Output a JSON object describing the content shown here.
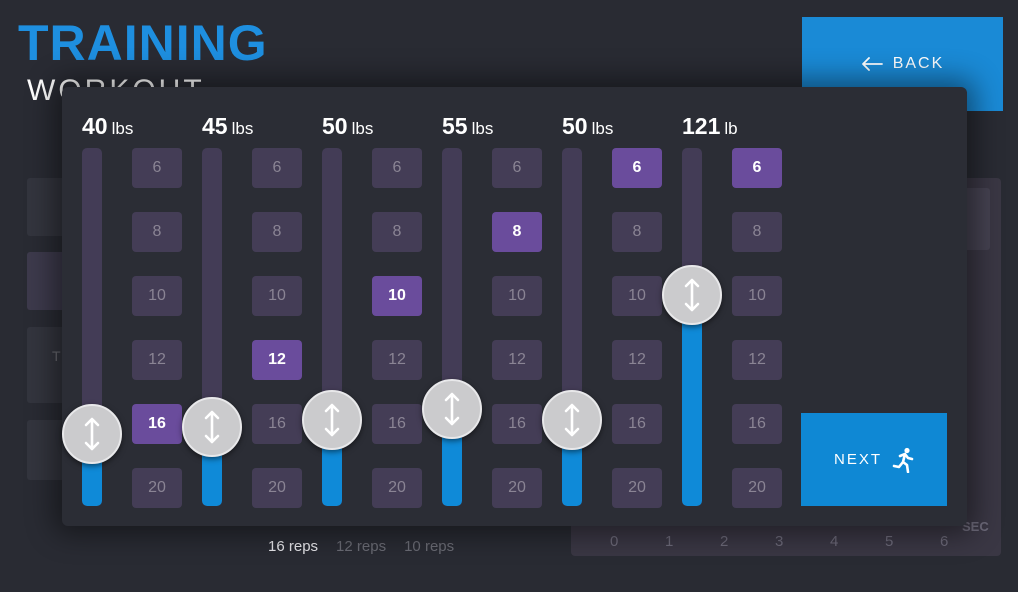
{
  "header": {
    "title": "TRAINING",
    "subtitle": "WORKOUT"
  },
  "back_button": {
    "label": "BACK",
    "icon": "arrow-left-icon"
  },
  "background": {
    "side_letter": "T",
    "reps_strip": [
      {
        "label": "16 reps",
        "active": true
      },
      {
        "label": "12 reps",
        "active": false
      },
      {
        "label": "10 reps",
        "active": false
      }
    ],
    "chart": {
      "unit_label": "SEC",
      "x_ticks": [
        "0",
        "1",
        "2",
        "3",
        "4",
        "5",
        "6"
      ]
    }
  },
  "modal": {
    "columns": [
      {
        "weight": "40",
        "unit": "lbs",
        "level": 0.2,
        "selected_rep": "16"
      },
      {
        "weight": "45",
        "unit": "lbs",
        "level": 0.22,
        "selected_rep": "12"
      },
      {
        "weight": "50",
        "unit": "lbs",
        "level": 0.24,
        "selected_rep": "10"
      },
      {
        "weight": "55",
        "unit": "lbs",
        "level": 0.27,
        "selected_rep": "8"
      },
      {
        "weight": "50",
        "unit": "lbs",
        "level": 0.24,
        "selected_rep": "6"
      },
      {
        "weight": "121",
        "unit": "lb",
        "level": 0.59,
        "selected_rep": "6"
      }
    ],
    "rep_options": [
      "6",
      "8",
      "10",
      "12",
      "16",
      "20"
    ],
    "next_button": {
      "label": "NEXT",
      "icon": "running-person-icon"
    }
  },
  "colors": {
    "accent_blue": "#0f88d4",
    "selected_purple": "#6a4c9c",
    "track_purple": "#433c56"
  }
}
